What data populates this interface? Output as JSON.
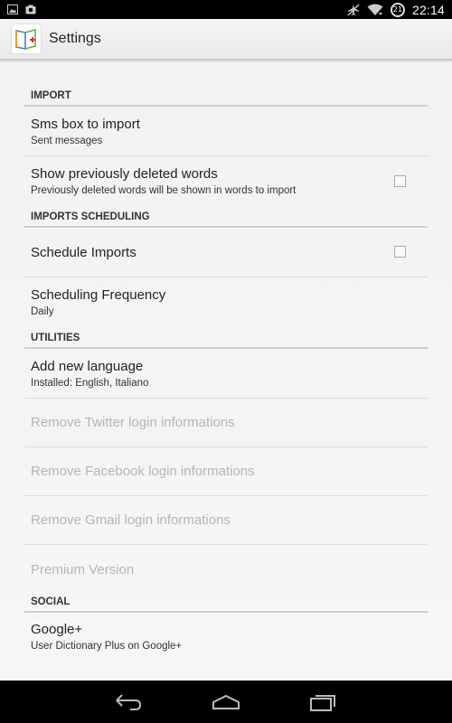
{
  "status_bar": {
    "time": "22:14",
    "battery_level": "21",
    "left_icons": [
      "image-icon",
      "camera-icon"
    ],
    "right_icons": [
      "airplane-mode-icon",
      "wifi-icon",
      "battery-icon"
    ]
  },
  "action_bar": {
    "title": "Settings",
    "app_icon": "dictionary-plus-icon"
  },
  "sections": {
    "import": {
      "header": "IMPORT",
      "items": [
        {
          "title": "Sms box to import",
          "summary": "Sent messages"
        },
        {
          "title": "Show previously deleted words",
          "summary": "Previously deleted words will be shown in words to import",
          "checked": false
        }
      ]
    },
    "scheduling": {
      "header": "IMPORTS SCHEDULING",
      "items": [
        {
          "title": "Schedule Imports",
          "checked": false
        },
        {
          "title": "Scheduling Frequency",
          "summary": "Daily"
        }
      ]
    },
    "utilities": {
      "header": "UTILITIES",
      "items": [
        {
          "title": "Add new language",
          "summary": "Installed: English, Italiano"
        },
        {
          "title": "Remove Twitter login informations",
          "enabled": false
        },
        {
          "title": "Remove Facebook login informations",
          "enabled": false
        },
        {
          "title": "Remove Gmail login informations",
          "enabled": false
        },
        {
          "title": "Premium Version",
          "enabled": false
        }
      ]
    },
    "social": {
      "header": "SOCIAL",
      "items": [
        {
          "title": "Google+",
          "summary": "User Dictionary Plus on Google+"
        }
      ]
    }
  },
  "nav_bar": {
    "buttons": [
      "back-icon",
      "home-icon",
      "recent-apps-icon"
    ]
  },
  "colors": {
    "status_bar_bg": "#000000",
    "action_bar_bg": "#eeeeee",
    "content_bg": "#f2f2f2",
    "disabled_text": "#b5b5b5",
    "divider": "#cfcfcf"
  }
}
